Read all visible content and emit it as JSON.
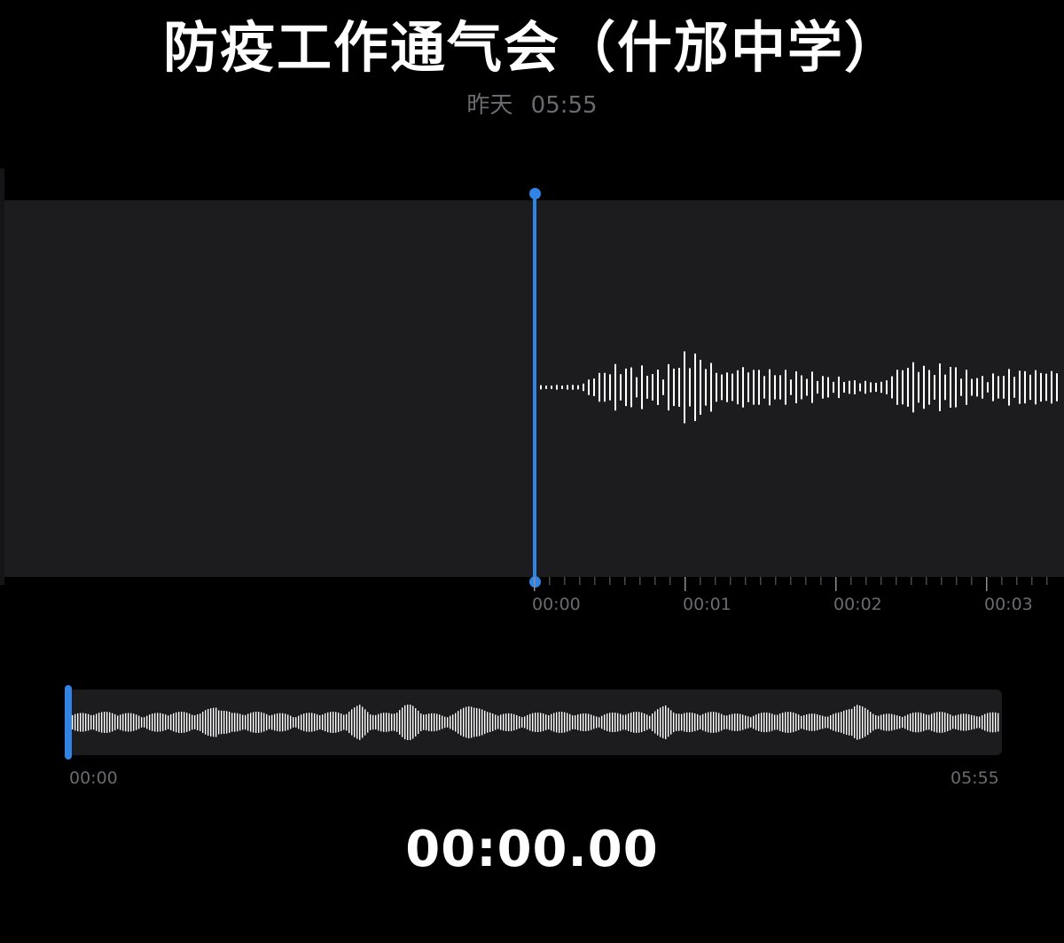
{
  "recording": {
    "title": "防疫工作通气会（什邡中学）",
    "date_label": "昨天",
    "time_label": "05:55"
  },
  "waveform": {
    "ruler_labels": [
      "00:00",
      "00:01",
      "00:02",
      "00:03"
    ],
    "playhead_time": "00:00"
  },
  "overview": {
    "start_label": "00:00",
    "end_label": "05:55"
  },
  "player": {
    "timer": "00:00.00"
  },
  "colors": {
    "accent": "#2f84e6",
    "panel": "#1c1c1e",
    "background": "#000000",
    "muted_text": "#6b6b6f",
    "waveform": "#ffffff"
  }
}
